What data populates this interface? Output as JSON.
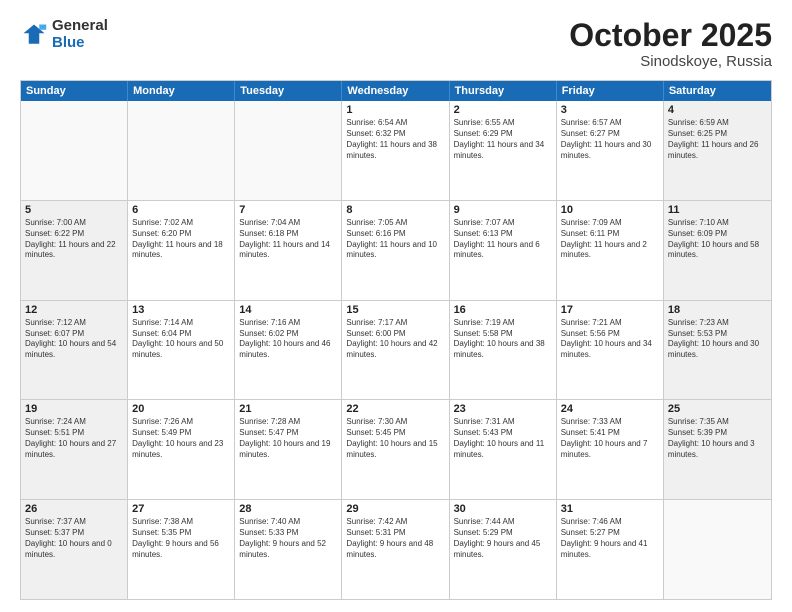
{
  "logo": {
    "general": "General",
    "blue": "Blue"
  },
  "header": {
    "month": "October 2025",
    "location": "Sinodskoye, Russia"
  },
  "weekdays": [
    "Sunday",
    "Monday",
    "Tuesday",
    "Wednesday",
    "Thursday",
    "Friday",
    "Saturday"
  ],
  "rows": [
    [
      {
        "day": "",
        "sunrise": "",
        "sunset": "",
        "daylight": "",
        "shaded": false,
        "empty": true
      },
      {
        "day": "",
        "sunrise": "",
        "sunset": "",
        "daylight": "",
        "shaded": false,
        "empty": true
      },
      {
        "day": "",
        "sunrise": "",
        "sunset": "",
        "daylight": "",
        "shaded": false,
        "empty": true
      },
      {
        "day": "1",
        "sunrise": "Sunrise: 6:54 AM",
        "sunset": "Sunset: 6:32 PM",
        "daylight": "Daylight: 11 hours and 38 minutes.",
        "shaded": false,
        "empty": false
      },
      {
        "day": "2",
        "sunrise": "Sunrise: 6:55 AM",
        "sunset": "Sunset: 6:29 PM",
        "daylight": "Daylight: 11 hours and 34 minutes.",
        "shaded": false,
        "empty": false
      },
      {
        "day": "3",
        "sunrise": "Sunrise: 6:57 AM",
        "sunset": "Sunset: 6:27 PM",
        "daylight": "Daylight: 11 hours and 30 minutes.",
        "shaded": false,
        "empty": false
      },
      {
        "day": "4",
        "sunrise": "Sunrise: 6:59 AM",
        "sunset": "Sunset: 6:25 PM",
        "daylight": "Daylight: 11 hours and 26 minutes.",
        "shaded": true,
        "empty": false
      }
    ],
    [
      {
        "day": "5",
        "sunrise": "Sunrise: 7:00 AM",
        "sunset": "Sunset: 6:22 PM",
        "daylight": "Daylight: 11 hours and 22 minutes.",
        "shaded": true,
        "empty": false
      },
      {
        "day": "6",
        "sunrise": "Sunrise: 7:02 AM",
        "sunset": "Sunset: 6:20 PM",
        "daylight": "Daylight: 11 hours and 18 minutes.",
        "shaded": false,
        "empty": false
      },
      {
        "day": "7",
        "sunrise": "Sunrise: 7:04 AM",
        "sunset": "Sunset: 6:18 PM",
        "daylight": "Daylight: 11 hours and 14 minutes.",
        "shaded": false,
        "empty": false
      },
      {
        "day": "8",
        "sunrise": "Sunrise: 7:05 AM",
        "sunset": "Sunset: 6:16 PM",
        "daylight": "Daylight: 11 hours and 10 minutes.",
        "shaded": false,
        "empty": false
      },
      {
        "day": "9",
        "sunrise": "Sunrise: 7:07 AM",
        "sunset": "Sunset: 6:13 PM",
        "daylight": "Daylight: 11 hours and 6 minutes.",
        "shaded": false,
        "empty": false
      },
      {
        "day": "10",
        "sunrise": "Sunrise: 7:09 AM",
        "sunset": "Sunset: 6:11 PM",
        "daylight": "Daylight: 11 hours and 2 minutes.",
        "shaded": false,
        "empty": false
      },
      {
        "day": "11",
        "sunrise": "Sunrise: 7:10 AM",
        "sunset": "Sunset: 6:09 PM",
        "daylight": "Daylight: 10 hours and 58 minutes.",
        "shaded": true,
        "empty": false
      }
    ],
    [
      {
        "day": "12",
        "sunrise": "Sunrise: 7:12 AM",
        "sunset": "Sunset: 6:07 PM",
        "daylight": "Daylight: 10 hours and 54 minutes.",
        "shaded": true,
        "empty": false
      },
      {
        "day": "13",
        "sunrise": "Sunrise: 7:14 AM",
        "sunset": "Sunset: 6:04 PM",
        "daylight": "Daylight: 10 hours and 50 minutes.",
        "shaded": false,
        "empty": false
      },
      {
        "day": "14",
        "sunrise": "Sunrise: 7:16 AM",
        "sunset": "Sunset: 6:02 PM",
        "daylight": "Daylight: 10 hours and 46 minutes.",
        "shaded": false,
        "empty": false
      },
      {
        "day": "15",
        "sunrise": "Sunrise: 7:17 AM",
        "sunset": "Sunset: 6:00 PM",
        "daylight": "Daylight: 10 hours and 42 minutes.",
        "shaded": false,
        "empty": false
      },
      {
        "day": "16",
        "sunrise": "Sunrise: 7:19 AM",
        "sunset": "Sunset: 5:58 PM",
        "daylight": "Daylight: 10 hours and 38 minutes.",
        "shaded": false,
        "empty": false
      },
      {
        "day": "17",
        "sunrise": "Sunrise: 7:21 AM",
        "sunset": "Sunset: 5:56 PM",
        "daylight": "Daylight: 10 hours and 34 minutes.",
        "shaded": false,
        "empty": false
      },
      {
        "day": "18",
        "sunrise": "Sunrise: 7:23 AM",
        "sunset": "Sunset: 5:53 PM",
        "daylight": "Daylight: 10 hours and 30 minutes.",
        "shaded": true,
        "empty": false
      }
    ],
    [
      {
        "day": "19",
        "sunrise": "Sunrise: 7:24 AM",
        "sunset": "Sunset: 5:51 PM",
        "daylight": "Daylight: 10 hours and 27 minutes.",
        "shaded": true,
        "empty": false
      },
      {
        "day": "20",
        "sunrise": "Sunrise: 7:26 AM",
        "sunset": "Sunset: 5:49 PM",
        "daylight": "Daylight: 10 hours and 23 minutes.",
        "shaded": false,
        "empty": false
      },
      {
        "day": "21",
        "sunrise": "Sunrise: 7:28 AM",
        "sunset": "Sunset: 5:47 PM",
        "daylight": "Daylight: 10 hours and 19 minutes.",
        "shaded": false,
        "empty": false
      },
      {
        "day": "22",
        "sunrise": "Sunrise: 7:30 AM",
        "sunset": "Sunset: 5:45 PM",
        "daylight": "Daylight: 10 hours and 15 minutes.",
        "shaded": false,
        "empty": false
      },
      {
        "day": "23",
        "sunrise": "Sunrise: 7:31 AM",
        "sunset": "Sunset: 5:43 PM",
        "daylight": "Daylight: 10 hours and 11 minutes.",
        "shaded": false,
        "empty": false
      },
      {
        "day": "24",
        "sunrise": "Sunrise: 7:33 AM",
        "sunset": "Sunset: 5:41 PM",
        "daylight": "Daylight: 10 hours and 7 minutes.",
        "shaded": false,
        "empty": false
      },
      {
        "day": "25",
        "sunrise": "Sunrise: 7:35 AM",
        "sunset": "Sunset: 5:39 PM",
        "daylight": "Daylight: 10 hours and 3 minutes.",
        "shaded": true,
        "empty": false
      }
    ],
    [
      {
        "day": "26",
        "sunrise": "Sunrise: 7:37 AM",
        "sunset": "Sunset: 5:37 PM",
        "daylight": "Daylight: 10 hours and 0 minutes.",
        "shaded": true,
        "empty": false
      },
      {
        "day": "27",
        "sunrise": "Sunrise: 7:38 AM",
        "sunset": "Sunset: 5:35 PM",
        "daylight": "Daylight: 9 hours and 56 minutes.",
        "shaded": false,
        "empty": false
      },
      {
        "day": "28",
        "sunrise": "Sunrise: 7:40 AM",
        "sunset": "Sunset: 5:33 PM",
        "daylight": "Daylight: 9 hours and 52 minutes.",
        "shaded": false,
        "empty": false
      },
      {
        "day": "29",
        "sunrise": "Sunrise: 7:42 AM",
        "sunset": "Sunset: 5:31 PM",
        "daylight": "Daylight: 9 hours and 48 minutes.",
        "shaded": false,
        "empty": false
      },
      {
        "day": "30",
        "sunrise": "Sunrise: 7:44 AM",
        "sunset": "Sunset: 5:29 PM",
        "daylight": "Daylight: 9 hours and 45 minutes.",
        "shaded": false,
        "empty": false
      },
      {
        "day": "31",
        "sunrise": "Sunrise: 7:46 AM",
        "sunset": "Sunset: 5:27 PM",
        "daylight": "Daylight: 9 hours and 41 minutes.",
        "shaded": false,
        "empty": false
      },
      {
        "day": "",
        "sunrise": "",
        "sunset": "",
        "daylight": "",
        "shaded": true,
        "empty": true
      }
    ]
  ]
}
